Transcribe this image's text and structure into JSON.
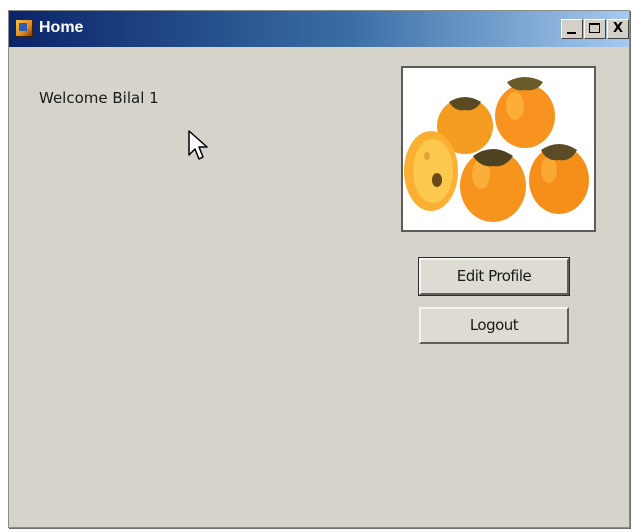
{
  "window": {
    "title": "Home",
    "controls": {
      "minimize_icon": "minimize-icon",
      "maximize_icon": "maximize-icon",
      "close_label": "X"
    },
    "colors": {
      "titlebar_start": "#0a246a",
      "titlebar_end": "#a6caf0",
      "body_background": "#d6d3ca"
    }
  },
  "main": {
    "welcome_text": "Welcome Bilal 1",
    "profile_picture": "persimmon-fruit-image",
    "buttons": {
      "edit_profile": "Edit Profile",
      "logout": "Logout"
    }
  }
}
